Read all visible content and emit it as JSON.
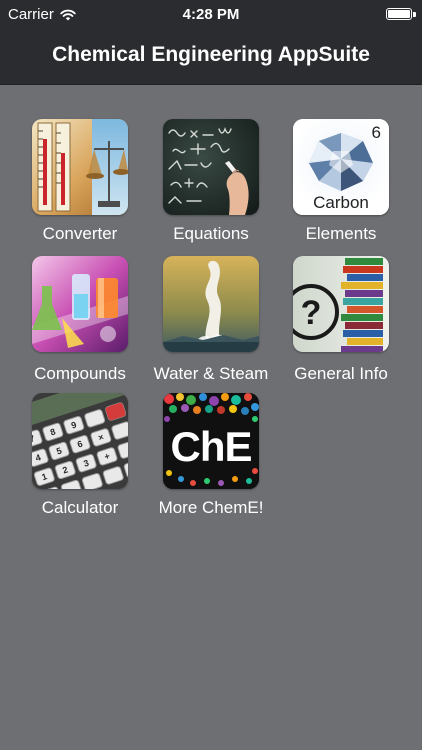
{
  "status_bar": {
    "carrier": "Carrier",
    "time": "4:28 PM",
    "wifi_icon": "wifi-icon",
    "battery_icon": "battery-icon",
    "battery_level": 1.0
  },
  "nav": {
    "title": "Chemical Engineering AppSuite"
  },
  "apps": [
    {
      "label": "Converter",
      "icon": "thermometer-scale-icon"
    },
    {
      "label": "Equations",
      "icon": "chalkboard-equations-icon"
    },
    {
      "label": "Elements",
      "icon": "diamond-carbon-icon",
      "element_symbol": "Carbon",
      "element_number": "6"
    },
    {
      "label": "Compounds",
      "icon": "lab-glassware-icon"
    },
    {
      "label": "Water & Steam",
      "icon": "steam-geyser-icon"
    },
    {
      "label": "General Info",
      "icon": "question-books-icon"
    },
    {
      "label": "Calculator",
      "icon": "calculator-keys-icon"
    },
    {
      "label": "More ChemE!",
      "icon": "che-logo-icon",
      "logo_text": "ChE"
    }
  ],
  "colors": {
    "background": "#6e6f73",
    "bar": "#2b2c2f",
    "text": "#ffffff"
  }
}
